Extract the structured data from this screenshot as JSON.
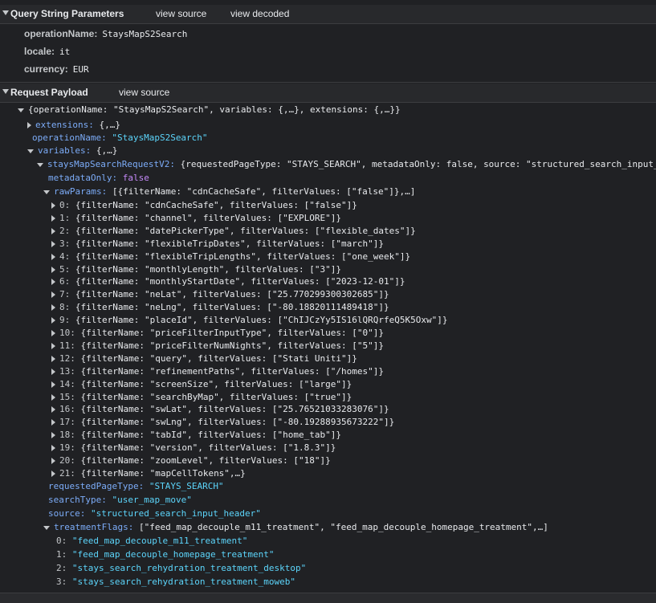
{
  "qs_header": {
    "title": "Query String Parameters",
    "view_source": "view source",
    "view_decoded": "view decoded"
  },
  "query_params": [
    {
      "key": "operationName:",
      "value": "StaysMapS2Search"
    },
    {
      "key": "locale:",
      "value": "it"
    },
    {
      "key": "currency:",
      "value": "EUR"
    }
  ],
  "payload_header": {
    "title": "Request Payload",
    "view_source": "view source"
  },
  "root_summary": "{operationName: \"StaysMapS2Search\", variables: {,…}, extensions: {,…}}",
  "extensions": {
    "key": "extensions:",
    "value": "{,…}"
  },
  "operationName": {
    "key": "operationName:",
    "value": "\"StaysMapS2Search\""
  },
  "variables": {
    "key": "variables:",
    "value": "{,…}"
  },
  "staysMapSearchRequestV2": {
    "key": "staysMapSearchRequestV2:",
    "value": "{requestedPageType: \"STAYS_SEARCH\", metadataOnly: false, source: \"structured_search_input_"
  },
  "metadataOnly": {
    "key": "metadataOnly:",
    "value": "false"
  },
  "rawParams": {
    "key": "rawParams:",
    "value": "[{filterName: \"cdnCacheSafe\", filterValues: [\"false\"]},…]"
  },
  "raw_items": [
    {
      "idx": "0:",
      "text": "{filterName: \"cdnCacheSafe\", filterValues: [\"false\"]}"
    },
    {
      "idx": "1:",
      "text": "{filterName: \"channel\", filterValues: [\"EXPLORE\"]}"
    },
    {
      "idx": "2:",
      "text": "{filterName: \"datePickerType\", filterValues: [\"flexible_dates\"]}"
    },
    {
      "idx": "3:",
      "text": "{filterName: \"flexibleTripDates\", filterValues: [\"march\"]}"
    },
    {
      "idx": "4:",
      "text": "{filterName: \"flexibleTripLengths\", filterValues: [\"one_week\"]}"
    },
    {
      "idx": "5:",
      "text": "{filterName: \"monthlyLength\", filterValues: [\"3\"]}"
    },
    {
      "idx": "6:",
      "text": "{filterName: \"monthlyStartDate\", filterValues: [\"2023-12-01\"]}"
    },
    {
      "idx": "7:",
      "text": "{filterName: \"neLat\", filterValues: [\"25.770299300302685\"]}"
    },
    {
      "idx": "8:",
      "text": "{filterName: \"neLng\", filterValues: [\"-80.18820111489418\"]}"
    },
    {
      "idx": "9:",
      "text": "{filterName: \"placeId\", filterValues: [\"ChIJCzYy5IS16lQRQrfeQ5K5Oxw\"]}"
    },
    {
      "idx": "10:",
      "text": "{filterName: \"priceFilterInputType\", filterValues: [\"0\"]}"
    },
    {
      "idx": "11:",
      "text": "{filterName: \"priceFilterNumNights\", filterValues: [\"5\"]}"
    },
    {
      "idx": "12:",
      "text": "{filterName: \"query\", filterValues: [\"Stati Uniti\"]}"
    },
    {
      "idx": "13:",
      "text": "{filterName: \"refinementPaths\", filterValues: [\"/homes\"]}"
    },
    {
      "idx": "14:",
      "text": "{filterName: \"screenSize\", filterValues: [\"large\"]}"
    },
    {
      "idx": "15:",
      "text": "{filterName: \"searchByMap\", filterValues: [\"true\"]}"
    },
    {
      "idx": "16:",
      "text": "{filterName: \"swLat\", filterValues: [\"25.76521033283076\"]}"
    },
    {
      "idx": "17:",
      "text": "{filterName: \"swLng\", filterValues: [\"-80.19288935673222\"]}"
    },
    {
      "idx": "18:",
      "text": "{filterName: \"tabId\", filterValues: [\"home_tab\"]}"
    },
    {
      "idx": "19:",
      "text": "{filterName: \"version\", filterValues: [\"1.8.3\"]}"
    },
    {
      "idx": "20:",
      "text": "{filterName: \"zoomLevel\", filterValues: [\"18\"]}"
    },
    {
      "idx": "21:",
      "text": "{filterName: \"mapCellTokens\",…}"
    }
  ],
  "requestedPageType": {
    "key": "requestedPageType:",
    "value": "\"STAYS_SEARCH\""
  },
  "searchType": {
    "key": "searchType:",
    "value": "\"user_map_move\""
  },
  "source": {
    "key": "source:",
    "value": "\"structured_search_input_header\""
  },
  "treatmentFlags": {
    "key": "treatmentFlags:",
    "value": "[\"feed_map_decouple_m11_treatment\", \"feed_map_decouple_homepage_treatment\",…]"
  },
  "treatment_items": [
    {
      "idx": "0:",
      "value": "\"feed_map_decouple_m11_treatment\""
    },
    {
      "idx": "1:",
      "value": "\"feed_map_decouple_homepage_treatment\""
    },
    {
      "idx": "2:",
      "value": "\"stays_search_rehydration_treatment_desktop\""
    },
    {
      "idx": "3:",
      "value": "\"stays_search_rehydration_treatment_moweb\""
    }
  ]
}
